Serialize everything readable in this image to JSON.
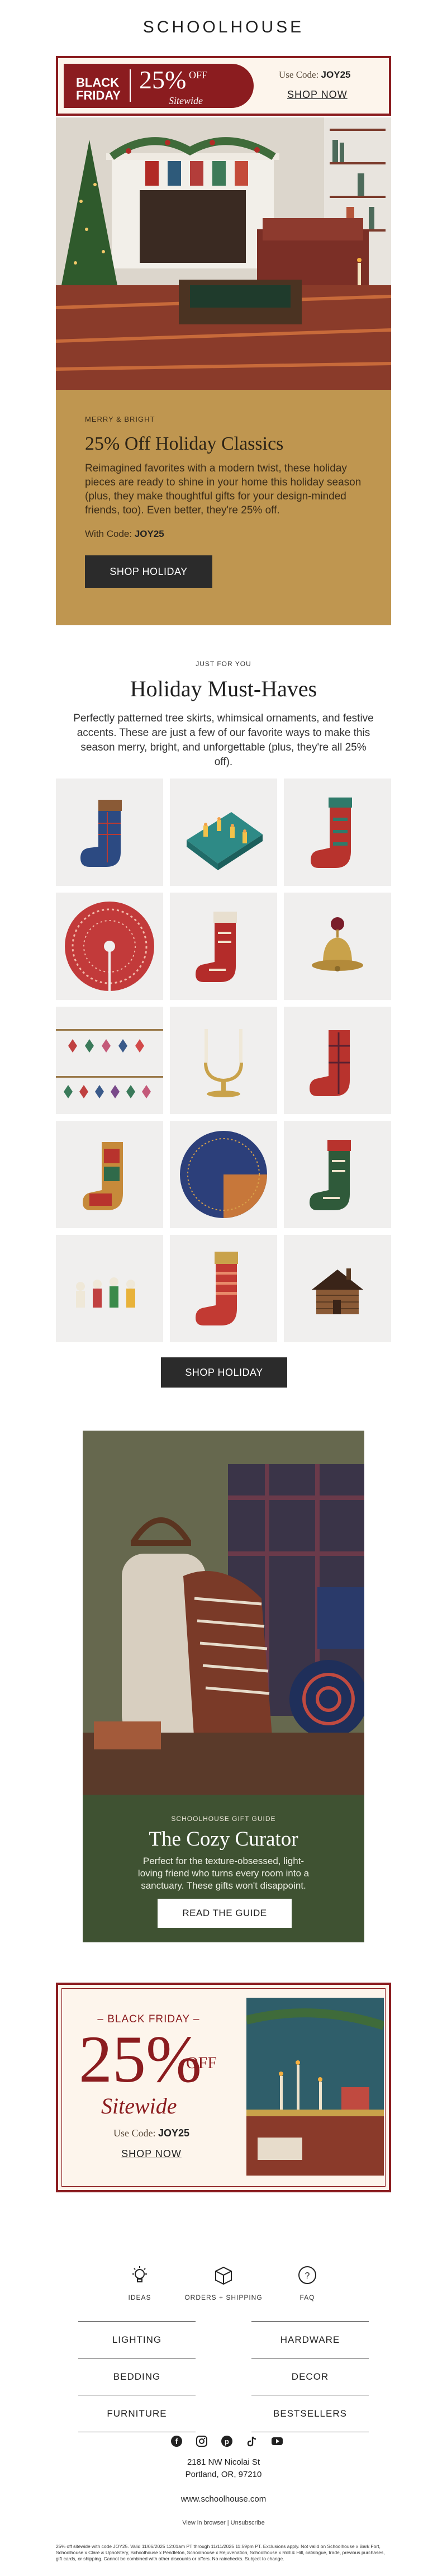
{
  "header": {
    "logo": "SCHOOLHOUSE"
  },
  "top_banner": {
    "black_friday": "BLACK FRIDAY",
    "percent": "25%",
    "off": "OFF",
    "sitewide": "Sitewide",
    "code_label": "Use Code:",
    "code": "JOY25",
    "shop_now": "SHOP NOW"
  },
  "hero": {
    "eyebrow": "MERRY & BRIGHT",
    "title": "25% Off Holiday Classics",
    "body": "Reimagined favorites with a modern twist, these holiday pieces are ready to shine in your home this holiday season (plus, they make thoughtful gifts for your design-minded friends, too). Even better, they're 25% off.",
    "code_label": "With Code:",
    "code": "JOY25",
    "button": "SHOP HOLIDAY"
  },
  "must_haves": {
    "eyebrow": "JUST FOR YOU",
    "title": "Holiday Must-Haves",
    "body": "Perfectly patterned tree skirts, whimsical ornaments, and festive accents. These are just a few of our favorite ways to make this season merry, bright, and unforgettable (plus, they're all 25% off).",
    "products": [
      "blue plaid stocking",
      "advent candle box",
      "red pattern stocking",
      "red tree skirt",
      "red nordic stocking",
      "brass bell",
      "glass ornaments set",
      "brass candle holder",
      "plaid stocking",
      "patchwork stocking",
      "blue tree skirt",
      "green nordic stocking",
      "wooden figurines",
      "red striped stocking",
      "wooden cabin ornament"
    ],
    "button": "SHOP HOLIDAY"
  },
  "gift_guide": {
    "eyebrow": "SCHOOLHOUSE GIFT GUIDE",
    "title": "The Cozy Curator",
    "body": "Perfect for the texture-obsessed, light-loving friend who turns every room into a sanctuary. These gifts won't disappoint.",
    "button": "READ THE GUIDE"
  },
  "bottom_promo": {
    "black_friday": "– BLACK FRIDAY –",
    "percent": "25%",
    "off": "OFF",
    "sitewide": "Sitewide",
    "code_label": "Use Code:",
    "code": "JOY25",
    "shop_now": "SHOP NOW"
  },
  "footer_icons": [
    {
      "label": "IDEAS",
      "icon": "lightbulb-icon"
    },
    {
      "label": "ORDERS + SHIPPING",
      "icon": "box-icon"
    },
    {
      "label": "FAQ",
      "icon": "question-icon"
    }
  ],
  "footer_links": [
    "LIGHTING",
    "HARDWARE",
    "BEDDING",
    "DECOR",
    "FURNITURE",
    "BESTSELLERS"
  ],
  "social_icons": [
    "facebook-icon",
    "instagram-icon",
    "pinterest-icon",
    "tiktok-icon",
    "youtube-icon"
  ],
  "address": {
    "line1": "2181 NW Nicolai St",
    "line2": "Portland, OR, 97210"
  },
  "website": "www.schoolhouse.com",
  "view_in_browser": "View in browser",
  "unsubscribe": "Unsubscribe",
  "legal": "25% off sitewide with code JOY25. Valid 11/06/2025 12:01am PT through 11/11/2025 11:59pm PT. Exclusions apply. Not valid on Schoolhouse x Bark Fort, Schoolhouse x Clare & Upholstery, Schoolhouse x Pendleton, Schoolhouse x Rejuvenation, Schoolhouse x Roll & Hill, catalogue, trade, previous purchases, gift cards, or shipping. Cannot be combined with other discounts or offers. No rainchecks. Subject to change.",
  "colors": {
    "brand_red": "#8b1c1f",
    "gold": "#bf9650",
    "forest": "#3f5232",
    "dark_button": "#2b2b2b"
  }
}
